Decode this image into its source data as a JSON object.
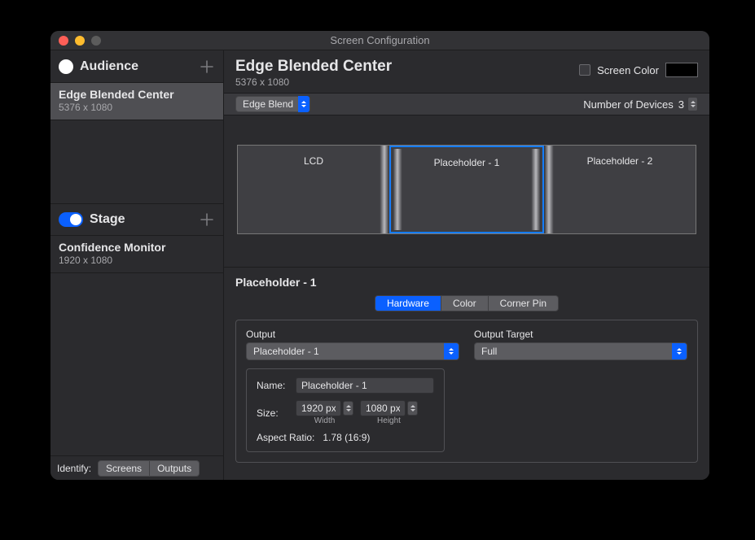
{
  "window": {
    "title": "Screen Configuration"
  },
  "sidebar": {
    "audience": {
      "title": "Audience",
      "items": [
        {
          "name": "Edge Blended Center",
          "sub": "5376 x 1080"
        }
      ]
    },
    "stage": {
      "title": "Stage",
      "items": [
        {
          "name": "Confidence Monitor",
          "sub": "1920 x 1080"
        }
      ]
    },
    "footer": {
      "identify_label": "Identify:",
      "screens": "Screens",
      "outputs": "Outputs"
    }
  },
  "main": {
    "title": "Edge Blended Center",
    "subtitle": "5376 x 1080",
    "screen_color_label": "Screen Color",
    "mode": "Edge Blend",
    "num_devices_label": "Number of Devices",
    "num_devices": "3",
    "devices": [
      "LCD",
      "Placeholder - 1",
      "Placeholder - 2"
    ]
  },
  "detail": {
    "title": "Placeholder - 1",
    "tabs": [
      "Hardware",
      "Color",
      "Corner Pin"
    ],
    "output_label": "Output",
    "output_value": "Placeholder - 1",
    "output_target_label": "Output Target",
    "output_target_value": "Full",
    "name_label": "Name:",
    "name_value": "Placeholder - 1",
    "size_label": "Size:",
    "width_value": "1920 px",
    "width_caption": "Width",
    "height_value": "1080 px",
    "height_caption": "Height",
    "aspect_label": "Aspect Ratio:",
    "aspect_value": "1.78 (16:9)"
  }
}
